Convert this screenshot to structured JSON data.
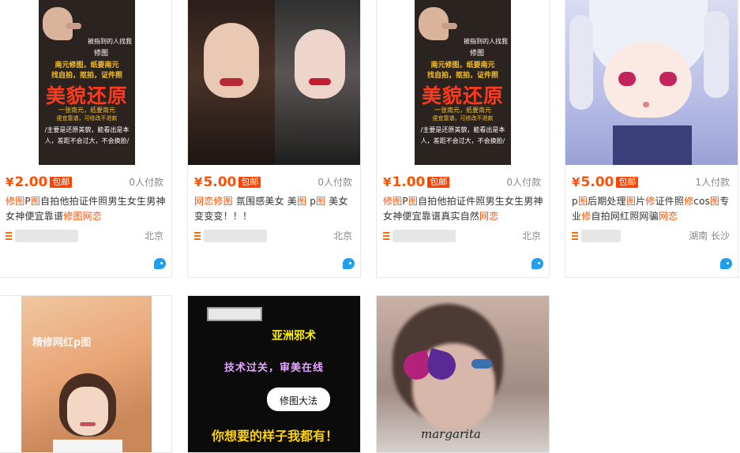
{
  "products": [
    {
      "image_texts": [
        "被指到的人找我",
        "修图",
        "南元修图，纸要南元",
        "找自拍，抠拍，证件照",
        "美貌还原",
        "一张南元，纸要南元",
        "便宜靠谱，可修改不退款",
        "/主要是还原美貌，能看出是本",
        "人，差距不会过大，不会换脸/"
      ],
      "currency": "¥",
      "price": "2.00",
      "badge": "包邮",
      "paid": "0人付款",
      "title": [
        {
          "t": "修图",
          "hl": true
        },
        {
          "t": "P",
          "hl": false
        },
        {
          "t": "图",
          "hl": true
        },
        {
          "t": "自拍他拍证件照男生女生男神女神便宜靠谱",
          "hl": false
        },
        {
          "t": "修图",
          "hl": true
        },
        {
          "t": "网恋",
          "hl": true
        }
      ],
      "shop": "shop",
      "location": "北京"
    },
    {
      "image_texts": [],
      "currency": "¥",
      "price": "5.00",
      "badge": "包邮",
      "paid": "0人付款",
      "title": [
        {
          "t": "网恋",
          "hl": true
        },
        {
          "t": "修图",
          "hl": true
        },
        {
          "t": " 氛围感美女 美",
          "hl": false
        },
        {
          "t": "图",
          "hl": true
        },
        {
          "t": " p",
          "hl": false
        },
        {
          "t": "图",
          "hl": true
        },
        {
          "t": " 美女变变变！！！",
          "hl": false
        }
      ],
      "shop": "shop",
      "location": "北京"
    },
    {
      "image_texts": [
        "被指到的人找我",
        "修图",
        "南元修图，纸要南元",
        "找自拍，抠拍，证件照",
        "美貌还原",
        "一张南元，纸要南元",
        "便宜靠谱，可修改不退款",
        "/主要是还原美貌，能看出是本",
        "人，差距不会过大，不会换脸/"
      ],
      "currency": "¥",
      "price": "1.00",
      "badge": "包邮",
      "paid": "0人付款",
      "title": [
        {
          "t": "修图",
          "hl": true
        },
        {
          "t": "P",
          "hl": false
        },
        {
          "t": "图",
          "hl": true
        },
        {
          "t": "自拍他拍证件照男生女生男神女神便宜靠谱真实自然",
          "hl": false
        },
        {
          "t": "网恋",
          "hl": true
        }
      ],
      "shop": "shop",
      "location": "北京"
    },
    {
      "image_texts": [],
      "currency": "¥",
      "price": "5.00",
      "badge": "包邮",
      "paid": "1人付款",
      "title": [
        {
          "t": "p",
          "hl": false
        },
        {
          "t": "图",
          "hl": true
        },
        {
          "t": "后期处理",
          "hl": false
        },
        {
          "t": "图",
          "hl": true
        },
        {
          "t": "片",
          "hl": false
        },
        {
          "t": "修",
          "hl": true
        },
        {
          "t": "证件照",
          "hl": false
        },
        {
          "t": "修",
          "hl": true
        },
        {
          "t": "cos",
          "hl": false
        },
        {
          "t": "图",
          "hl": true
        },
        {
          "t": "专业",
          "hl": false
        },
        {
          "t": "修",
          "hl": true
        },
        {
          "t": "自拍网红照网骗",
          "hl": false
        },
        {
          "t": "网恋",
          "hl": true
        }
      ],
      "shop": "shop",
      "location": "湖南 长沙"
    },
    {
      "image_texts": [
        "精修网红p图"
      ]
    },
    {
      "image_texts": [
        "亚洲邪术",
        "技术过关，审美在线",
        "修图大法",
        "你想要的样子我都有！"
      ]
    },
    {
      "image_texts": [
        "margarita"
      ]
    }
  ],
  "colors": {
    "price": "#ff5000",
    "badge_bg": "#ff4200",
    "highlight": "#ff5000",
    "wangwang": "#1f9ff0"
  },
  "icons": {
    "shop": "shop-icon",
    "chat": "wangwang-chat-icon"
  }
}
